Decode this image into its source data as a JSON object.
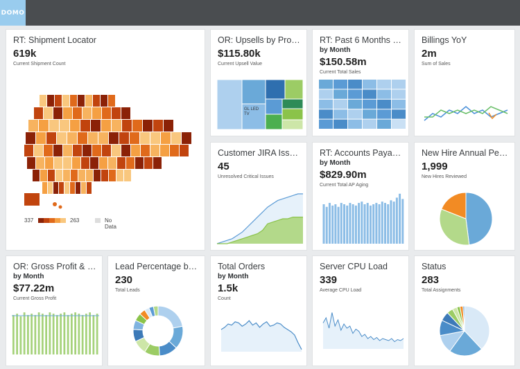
{
  "app": {
    "logo": "DOMO"
  },
  "cards": {
    "shipment": {
      "title": "RT: Shipment Locator",
      "value": "619k",
      "desc": "Current Shipment Count",
      "legend_min": "337",
      "legend_max": "263",
      "legend_nodata": "No Data"
    },
    "upsells": {
      "title": "OR: Upsells by Product",
      "value": "$115.80k",
      "desc": "Current Upsell Value",
      "tile_label": "GL LED TV"
    },
    "past6": {
      "title": "RT: Past 6 Months Sal...",
      "sub": "by Month",
      "value": "$150.58m",
      "desc": "Current Total Sales"
    },
    "billings": {
      "title": "Billings YoY",
      "value": "2m",
      "desc": "Sum of Sales"
    },
    "jira": {
      "title": "Customer JIRA Issues ...",
      "value": "45",
      "desc": "Unresolved Critical Issues"
    },
    "ap": {
      "title": "RT: Accounts Payable ...",
      "sub": "by Month",
      "value": "$829.90m",
      "desc": "Current Total AP Aging"
    },
    "newhire": {
      "title": "New Hire Annual Perf...",
      "value": "1,999",
      "desc": "New Hires Reviewed"
    },
    "gross": {
      "title": "OR: Gross Profit & Gr...",
      "sub": "by Month",
      "value": "$77.22m",
      "desc": "Current Gross Profit"
    },
    "lead": {
      "title": "Lead Percentage by P...",
      "value": "230",
      "desc": "Total Leads"
    },
    "orders": {
      "title": "Total Orders",
      "sub": "by Month",
      "value": "1.5k",
      "desc": "Count"
    },
    "cpu": {
      "title": "Server CPU Load",
      "value": "339",
      "desc": "Average CPU Load"
    },
    "status": {
      "title": "Status",
      "value": "283",
      "desc": "Total Assignments"
    }
  },
  "colors": {
    "accent_blue": "#6aa9d8",
    "light_blue": "#aed0ee",
    "green": "#9ccc65",
    "orange": "#f28b24",
    "dark_orange": "#c1440e"
  },
  "chart_data": [
    {
      "type": "pie",
      "title": "New Hire Annual Perf...",
      "values": [
        48,
        33,
        19
      ]
    },
    {
      "type": "line",
      "title": "Billings YoY",
      "series": [
        {
          "values": [
            3,
            5,
            4,
            6,
            5,
            7,
            5,
            6,
            4,
            5,
            6
          ]
        },
        {
          "values": [
            4,
            4,
            6,
            5,
            6,
            5,
            6,
            5,
            7,
            6,
            5
          ]
        }
      ]
    },
    {
      "type": "area",
      "title": "Customer JIRA Issues ...",
      "series": [
        {
          "values": [
            0,
            1,
            2,
            3,
            5,
            7,
            10,
            13,
            16,
            19,
            22,
            24,
            26,
            27,
            28,
            29,
            30,
            30
          ]
        },
        {
          "values": [
            0,
            0,
            0,
            1,
            2,
            3,
            4,
            5,
            6,
            8,
            12,
            13,
            14,
            15,
            15,
            16,
            16,
            16
          ]
        }
      ]
    },
    {
      "type": "bar",
      "title": "RT: Accounts Payable ...",
      "values": [
        30,
        28,
        31,
        29,
        30,
        28,
        31,
        30,
        29,
        31,
        30,
        29,
        31,
        32,
        30,
        31,
        29,
        30,
        31,
        30,
        32,
        31,
        30,
        33,
        32,
        35,
        38,
        34
      ]
    },
    {
      "type": "bar",
      "title": "OR: Gross Profit & Gr...",
      "values": [
        30,
        31,
        29,
        32,
        30,
        31,
        30,
        32,
        31,
        30,
        32,
        31,
        30,
        31,
        32,
        30,
        31,
        32,
        31,
        30,
        31,
        32,
        30,
        31
      ]
    },
    {
      "type": "area",
      "title": "Total Orders",
      "values": [
        20,
        22,
        25,
        24,
        27,
        26,
        23,
        25,
        28,
        24,
        26,
        22,
        25,
        27,
        23,
        24,
        26,
        25,
        22,
        20,
        18,
        15,
        8,
        2
      ]
    },
    {
      "type": "line",
      "title": "Server CPU Load",
      "values": [
        25,
        30,
        20,
        35,
        22,
        28,
        18,
        24,
        20,
        22,
        15,
        19,
        17,
        12,
        14,
        10,
        12,
        9,
        11,
        8,
        10,
        9,
        8,
        10,
        7,
        9,
        8,
        10
      ]
    },
    {
      "type": "pie",
      "title": "Status",
      "values": [
        38,
        22,
        12,
        10,
        6,
        4,
        3,
        2,
        2,
        1
      ]
    },
    {
      "type": "pie",
      "title": "Lead Percentage by P...",
      "values": [
        22,
        15,
        12,
        10,
        9,
        8,
        6,
        5,
        4,
        3,
        3,
        3
      ]
    }
  ]
}
